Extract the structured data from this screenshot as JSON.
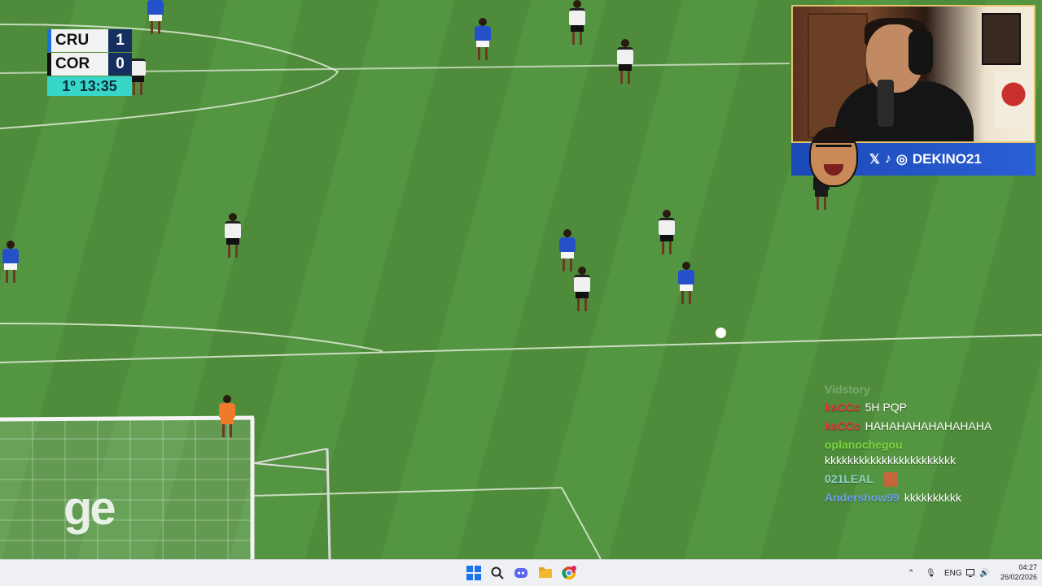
{
  "scoreboard": {
    "team1": "CRU",
    "score1": "1",
    "team2": "COR",
    "score2": "0",
    "clock": "1º 13:35"
  },
  "broadcast_logo": "ge",
  "streamer": {
    "handle": "DEKINO21",
    "social_icons": [
      "x-icon",
      "tiktok-icon",
      "instagram-icon"
    ]
  },
  "chat": {
    "faded_header": "Vidstory",
    "messages": [
      {
        "user": "ksCCc",
        "text": "5H PQP",
        "color": "#e8323c"
      },
      {
        "user": "ksCCc",
        "text": "HAHAHAHAHAHAHAHA",
        "color": "#e8323c"
      },
      {
        "user": "oplanochegou",
        "text": "kkkkkkkkkkkkkkkkkkkkkkk",
        "color": "#7bd63e"
      },
      {
        "user": "021LEAL",
        "text": "",
        "color": "#8fd3c9",
        "emote": "emote-face"
      },
      {
        "user": "Andershow99",
        "text": "kkkkkkkkkk",
        "color": "#6fa0e8"
      }
    ]
  },
  "taskbar": {
    "apps": [
      "windows-start-icon",
      "search-icon",
      "discord-icon",
      "file-explorer-icon",
      "chrome-icon"
    ],
    "tray": {
      "language": "ENG"
    },
    "time": "04:27",
    "date": "26/02/2026"
  },
  "colors": {
    "pitch": "#4e8c3b",
    "home_kit": "#2450c9",
    "away_kit": "#f0f0f0",
    "accent": "#37d6c8",
    "brand_bar": "#1c49b8"
  }
}
